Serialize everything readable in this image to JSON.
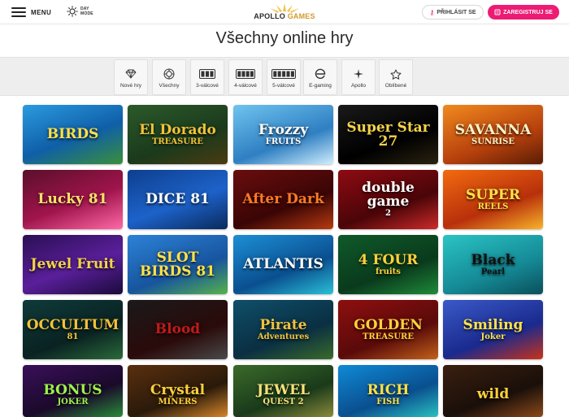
{
  "header": {
    "menu_label": "MENU",
    "day_mode_line1": "DAY",
    "day_mode_line2": "MODE",
    "logo_part1": "APOLLO",
    "logo_part2": "GAMES",
    "login_label": "PŘIHLÁSIT SE",
    "register_label": "ZAREGISTRUJ SE",
    "accent_color": "#ec1c74"
  },
  "page_title": "Všechny online hry",
  "filters": [
    {
      "label": "Nové hry",
      "icon": "diamond-icon"
    },
    {
      "label": "Všechny",
      "icon": "chip-icon"
    },
    {
      "label": "3-válcové",
      "icon": "reels-3-icon"
    },
    {
      "label": "4-válcové",
      "icon": "reels-4-icon"
    },
    {
      "label": "5-válcové",
      "icon": "reels-5-icon"
    },
    {
      "label": "E-gaming",
      "icon": "e-gaming-icon"
    },
    {
      "label": "Apollo",
      "icon": "apollo-star-icon"
    },
    {
      "label": "Oblíbené",
      "icon": "star-icon"
    }
  ],
  "games": [
    {
      "name": "BIRDS",
      "sub": "",
      "bg": "linear-gradient(160deg,#2b9be0,#0f5fa8 55%,#3a8f3a)",
      "color": "#ffe14a"
    },
    {
      "name": "El Dorado",
      "sub": "TREASURE",
      "bg": "linear-gradient(160deg,#2c5a2a,#1b3a1c 60%,#4a3b12)",
      "color": "#f2c23a"
    },
    {
      "name": "Frozzy",
      "sub": "FRUITS",
      "bg": "linear-gradient(160deg,#6fc4ef,#2f7fc2 60%,#cfeefc)",
      "color": "#ffffff"
    },
    {
      "name": "Super Star 27",
      "sub": "",
      "bg": "linear-gradient(160deg,#1a1a1a,#000000 60%,#2a2210)",
      "color": "#f4d24a"
    },
    {
      "name": "SAVANNA",
      "sub": "SUNRISE",
      "bg": "linear-gradient(160deg,#f08a1e,#b8410d 60%,#5a1d05)",
      "color": "#fff1c4"
    },
    {
      "name": "Lucky 81",
      "sub": "",
      "bg": "linear-gradient(160deg,#5a0f2a,#a0144c 55%,#ff6aa8)",
      "color": "#ffe06a"
    },
    {
      "name": "DICE 81",
      "sub": "",
      "bg": "linear-gradient(160deg,#0d3f8e,#1d62c9 55%,#0a2a5c)",
      "color": "#ffffff"
    },
    {
      "name": "After Dark",
      "sub": "",
      "bg": "linear-gradient(160deg,#6a0d0d,#3a0505 60%,#b83b10)",
      "color": "#ff7a24"
    },
    {
      "name": "double game",
      "sub": "2",
      "bg": "linear-gradient(160deg,#8e0b13,#4a0508 60%,#ce2a2a)",
      "color": "#ffffff"
    },
    {
      "name": "SUPER",
      "sub": "REELS",
      "bg": "linear-gradient(160deg,#f26b0f,#b8300b 60%,#f7b42a)",
      "color": "#ffe14a"
    },
    {
      "name": "Jewel Fruit",
      "sub": "",
      "bg": "linear-gradient(160deg,#2b0f55,#5a1f9a 55%,#1a0a3a)",
      "color": "#f4d24a"
    },
    {
      "name": "SLOT BIRDS 81",
      "sub": "",
      "bg": "linear-gradient(160deg,#2d82d8,#17559e 60%,#56b24a)",
      "color": "#ffe14a"
    },
    {
      "name": "ATLANTIS",
      "sub": "",
      "bg": "linear-gradient(160deg,#1d8fd6,#0a4f8f 60%,#2ac0d6)",
      "color": "#ffffff"
    },
    {
      "name": "4 FOUR",
      "sub": "fruits",
      "bg": "linear-gradient(160deg,#0f5a2a,#0a3a1c 60%,#1f8a3a)",
      "color": "#ffd23a"
    },
    {
      "name": "Black",
      "sub": "Pearl",
      "bg": "linear-gradient(160deg,#2ac4c4,#158a96 60%,#0a4f5a)",
      "color": "#111111"
    },
    {
      "name": "OCCULTUM",
      "sub": "81",
      "bg": "linear-gradient(160deg,#0f3a3a,#0a2222 60%,#2a6a3a)",
      "color": "#f2c23a"
    },
    {
      "name": "Blood",
      "sub": "",
      "bg": "linear-gradient(160deg,#1a1a1a,#2a0a0a 60%,#4a4a4a)",
      "color": "#c21a1a"
    },
    {
      "name": "Pirate",
      "sub": "Adventures",
      "bg": "linear-gradient(160deg,#0f4f6a,#0a2f42 60%,#3a6a2a)",
      "color": "#f2c23a"
    },
    {
      "name": "GOLDEN",
      "sub": "TREASURE",
      "bg": "linear-gradient(160deg,#8e0f0f,#5a0a0a 60%,#c2621a)",
      "color": "#ffd23a"
    },
    {
      "name": "Smiling",
      "sub": "Joker",
      "bg": "linear-gradient(160deg,#3a5ac8,#1a2a8e 60%,#c8321a)",
      "color": "#ffe14a"
    },
    {
      "name": "BONUS",
      "sub": "JOKER",
      "bg": "linear-gradient(160deg,#3a0f5a,#1a0a2a 60%,#2a8a3a)",
      "color": "#9df24a"
    },
    {
      "name": "Crystal",
      "sub": "MINERS",
      "bg": "linear-gradient(160deg,#5a2f0f,#2a1a0a 60%,#d6862a)",
      "color": "#ffd23a"
    },
    {
      "name": "JEWEL",
      "sub": "QUEST 2",
      "bg": "linear-gradient(160deg,#3a6a2a,#1a3a1a 60%,#8a8a3a)",
      "color": "#f7e27a"
    },
    {
      "name": "RICH",
      "sub": "FISH",
      "bg": "linear-gradient(160deg,#0f8ad6,#0a4f8f 60%,#2ac0c0)",
      "color": "#ffe14a"
    },
    {
      "name": "wild",
      "sub": "",
      "bg": "linear-gradient(160deg,#3a1f0f,#1a0f0a 60%,#8a4a1a)",
      "color": "#ffd23a"
    }
  ]
}
